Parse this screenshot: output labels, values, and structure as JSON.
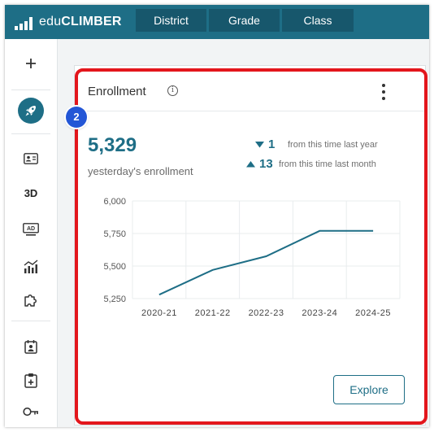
{
  "app": {
    "brand_prefix": "edu",
    "brand_main": "CLIMBER"
  },
  "nav": {
    "tabs": [
      {
        "label": "District"
      },
      {
        "label": "Grade"
      },
      {
        "label": "Class"
      }
    ]
  },
  "sidebar": {
    "items": [
      {
        "icon": "plus-icon"
      },
      {
        "icon": "rocket-icon"
      },
      {
        "icon": "id-card-icon"
      },
      {
        "icon": "3d-icon",
        "label": "3D"
      },
      {
        "icon": "ad-screen-icon",
        "label": "AD"
      },
      {
        "icon": "chart-bars-icon"
      },
      {
        "icon": "puzzle-icon"
      },
      {
        "icon": "calendar-user-icon"
      },
      {
        "icon": "clipboard-plus-icon"
      },
      {
        "icon": "key-icon"
      }
    ]
  },
  "card": {
    "title": "Enrollment",
    "info_symbol": "i",
    "value": "5,329",
    "value_caption": "yesterday's enrollment",
    "deltas": [
      {
        "direction": "down",
        "value": "1",
        "text": "from this time last year"
      },
      {
        "direction": "up",
        "value": "13",
        "text": "from this time last month"
      }
    ],
    "explore_label": "Explore"
  },
  "annotation": {
    "step": "2"
  },
  "colors": {
    "brand": "#1e6e86",
    "nav_tab": "#17576c",
    "highlight": "#e3161c",
    "step_badge": "#2356d6"
  },
  "chart_data": {
    "type": "line",
    "x": [
      "2020-21",
      "2021-22",
      "2022-23",
      "2023-24",
      "2024-25"
    ],
    "series": [
      {
        "values": [
          5280,
          5470,
          5575,
          5770,
          5770
        ]
      }
    ],
    "ylim": [
      5250,
      6000
    ],
    "yticks": [
      6000,
      5750,
      5500,
      5250
    ],
    "ytick_labels": [
      "6,000",
      "5,750",
      "5,500",
      "5,250"
    ],
    "grid": true,
    "title": "",
    "xlabel": "",
    "ylabel": ""
  }
}
